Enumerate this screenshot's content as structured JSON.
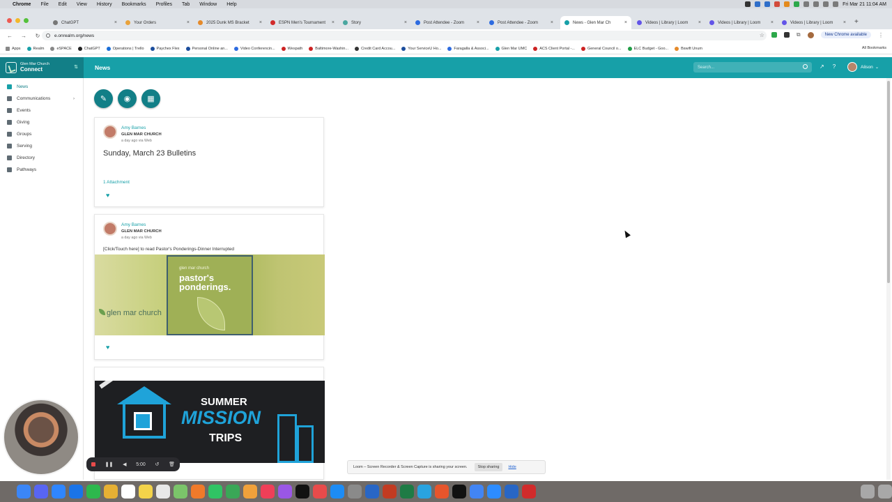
{
  "macbar": {
    "menus": [
      "Chrome",
      "File",
      "Edit",
      "View",
      "History",
      "Bookmarks",
      "Profiles",
      "Tab",
      "Window",
      "Help"
    ],
    "clock": "Fri Mar 21  11:04 AM"
  },
  "tabs": [
    {
      "label": "ChatGPT"
    },
    {
      "label": "Your Orders"
    },
    {
      "label": "2025 Dunk MS Bracket"
    },
    {
      "label": "ESPN Men's Tournament"
    },
    {
      "label": "Story"
    },
    {
      "label": "Post Attendee - Zoom"
    },
    {
      "label": "Post Attendee - Zoom"
    },
    {
      "label": "News - Glen Mar Ch"
    },
    {
      "label": "Videos | Library | Loom"
    },
    {
      "label": "Videos | Library | Loom"
    },
    {
      "label": "Videos | Library | Loom"
    }
  ],
  "address": {
    "url": "e.onrealm.org/news",
    "new_chrome": "New Chrome available"
  },
  "bookmarks": {
    "items": [
      "Apps",
      "Realm",
      "eSPACE",
      "ChatGPT",
      "Operations | Trello",
      "Paychex Flex",
      "Personal Online an...",
      "Video Conferencin...",
      "Wespath",
      "Baltimore-Washin...",
      "Credit Card Accou...",
      "Your ServiceU Ho...",
      "Faragalla & Associ...",
      "Glen Mar UMC",
      "ACS Client Portal -...",
      "General Council o...",
      "ELC Budget - Goo...",
      "Bswift Unum"
    ],
    "all_label": "All Bookmarks"
  },
  "app": {
    "logo_line1": "Glen Mar Church",
    "logo_line2": "Connect",
    "page_title": "News",
    "search_placeholder": "Search...",
    "user_name": "Alison"
  },
  "sidebar": {
    "items": [
      {
        "label": "News"
      },
      {
        "label": "Communications"
      },
      {
        "label": "Events"
      },
      {
        "label": "Giving"
      },
      {
        "label": "Groups"
      },
      {
        "label": "Serving"
      },
      {
        "label": "Directory"
      },
      {
        "label": "Pathways"
      }
    ]
  },
  "posts": [
    {
      "author": "Amy Barnes",
      "church": "GLEN MAR CHURCH",
      "time": "a day ago via Web",
      "title": "Sunday, March 23 Bulletins",
      "attachment": "1 Attachment"
    },
    {
      "author": "Amy Barnes",
      "church": "GLEN MAR CHURCH",
      "time": "a day ago via Web",
      "text": "[Click/Touch here] to read Pastor's Ponderings-Dinner Interrupted",
      "banner_small": "glen mar church",
      "banner_big": "pastor's ponderings.",
      "banner_logo": "glen mar church"
    },
    {
      "banner_line1": "SUMMER",
      "banner_line2": "MISSION",
      "banner_line3": "TRIPS"
    }
  ],
  "loom": {
    "timer": "5:00",
    "share_text": "Loom – Screen Recorder & Screen Capture is sharing your screen.",
    "stop_label": "Stop sharing",
    "hide_label": "Hide"
  },
  "colors": {
    "brand": "#17a0a8",
    "brand_dark": "#127f87"
  }
}
